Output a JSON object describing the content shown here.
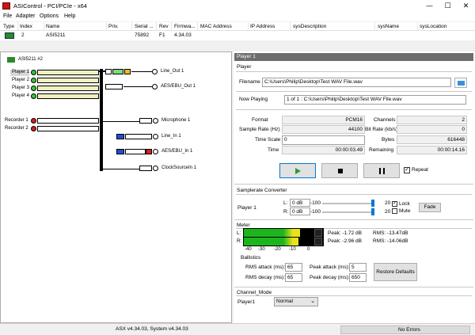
{
  "window": {
    "title": "ASIControl - PCI/PCIe - x64",
    "min": "—",
    "max": "☐",
    "close": "✕"
  },
  "menu": [
    "File",
    "Adapter",
    "Options",
    "Help"
  ],
  "adapter_table": {
    "headers": [
      "Type",
      "Index",
      "Name",
      "Priv.",
      "Serial ...",
      "Rev",
      "Firmwa...",
      "MAC Address",
      "IP Address",
      "sysDescription",
      "sysName",
      "sysLocation"
    ],
    "row": [
      "",
      "2",
      "ASI5211",
      "",
      "75892",
      "F1",
      "4.34.03",
      "",
      "",
      "",
      "",
      ""
    ]
  },
  "tree": {
    "root": "ASI5211 #2",
    "players": [
      "Player 1",
      "Player 2",
      "Player 3",
      "Player 4"
    ],
    "recorders": [
      "Recorder 1",
      "Recorder 2"
    ],
    "outputs": [
      "Line_Out 1",
      "AES/EBU_Out 1"
    ],
    "inputs": [
      "Microphone 1",
      "Line_In 1",
      "AES/EBU_In 1",
      "ClockSourceIn 1"
    ]
  },
  "tab": {
    "title": "Player 1"
  },
  "player": {
    "section": "Player",
    "filename_label": "Filename",
    "filename": "C:\\Users\\Philip\\Desktop\\Test WAV File.wav",
    "now_playing_label": "Now Playing",
    "now_playing": "1 of 1 : C:\\Users\\Philip\\Desktop\\Test WAV File.wav",
    "format_label": "Format",
    "format": "PCM16",
    "channels_label": "Channels",
    "channels": "2",
    "sample_rate_label": "Sample Rate (Hz)",
    "sample_rate": "44100",
    "bit_rate_label": "Bit Rate (kb/s)",
    "bit_rate": "0",
    "time_scale_label": "Time Scale",
    "time_scale": "0",
    "bytes_label": "Bytes",
    "bytes": "616448",
    "time_label": "Time",
    "time": "00:00:03.49",
    "remaining_label": "Remaining",
    "remaining": "00:00:14.16",
    "repeat_label": "Repeat",
    "repeat_checked": true
  },
  "src": {
    "section": "Samplerate Converter",
    "player_label": "Player 1",
    "l_label": "L:",
    "r_label": "R:",
    "l_value": "0 dB",
    "r_value": "0 dB",
    "min": "-100",
    "max": "20",
    "lock_label": "Lock",
    "mute_label": "Mute",
    "lock_checked": true,
    "mute_checked": false,
    "fade_label": "Fade",
    "l_level": 1.0,
    "r_level": 1.0
  },
  "meter": {
    "section": "Meter",
    "l_label": "L:",
    "r_label": "R:",
    "peak_l": "Peak: -1.72 dB",
    "peak_r": "Peak: -2.96 dB",
    "rms_l": "RMS: -13.47dB",
    "rms_r": "RMS: -14.06dB",
    "ticks": [
      "-40",
      "-30",
      "-20",
      "-10",
      "0"
    ],
    "l_level": 0.84,
    "r_level": 0.82
  },
  "ballistics": {
    "section": "Ballistics",
    "rms_attack_label": "RMS attack (ms):",
    "rms_attack": "65",
    "rms_decay_label": "RMS decay (ms):",
    "rms_decay": "65",
    "peak_attack_label": "Peak attack (ms):",
    "peak_attack": "5",
    "peak_decay_label": "Peak decay (ms):",
    "peak_decay": "650",
    "restore_label": "Restore Defaults"
  },
  "channel_mode": {
    "section": "Channel_Mode",
    "player_label": "Player1",
    "value": "Normal"
  },
  "status": {
    "version": "ASX v4.34.03, System v4.34.03",
    "errors": "No Errors"
  },
  "colors": {
    "accent": "#0078d7",
    "tab_header": "#6d6d6d",
    "meter_green": "#1db51d",
    "meter_yellow": "#e8e41c",
    "meter_red": "#d01010"
  }
}
